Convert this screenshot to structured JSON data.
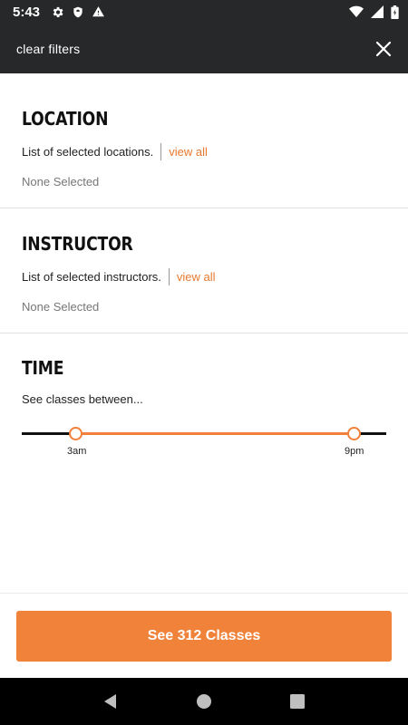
{
  "status_bar": {
    "time": "5:43",
    "icons_left": [
      "gear-icon",
      "shield-icon",
      "warning-icon"
    ],
    "icons_right": [
      "wifi-icon",
      "signal-icon",
      "battery-icon"
    ]
  },
  "header": {
    "clear_filters_label": "clear filters",
    "close_icon": "close-icon"
  },
  "sections": {
    "location": {
      "title": "LOCATION",
      "description": "List of selected locations.",
      "link": "view all",
      "selected": "None Selected"
    },
    "instructor": {
      "title": "INSTRUCTOR",
      "description": "List of selected instructors.",
      "link": "view all",
      "selected": "None Selected"
    },
    "time": {
      "title": "TIME",
      "description": "See classes between...",
      "start_label": "3am",
      "end_label": "9pm"
    }
  },
  "cta": {
    "label": "See 312 Classes"
  },
  "nav_bar": {
    "icons": [
      "back-icon",
      "home-icon",
      "recents-icon"
    ]
  },
  "colors": {
    "accent": "#f0823a",
    "link": "#e6792f",
    "header_bg": "#262829"
  }
}
